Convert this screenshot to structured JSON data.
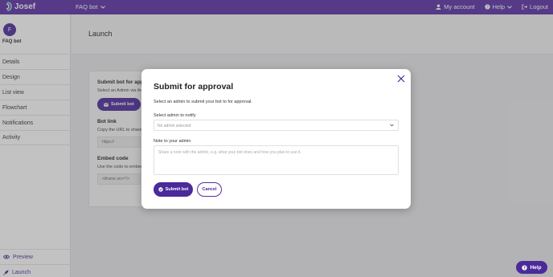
{
  "topbar": {
    "logo_text": "Josef",
    "bot_selector": "FAQ bot",
    "my_account": "My account",
    "help": "Help",
    "logout": "Logout"
  },
  "sidebar": {
    "avatar_letter": "F",
    "bot_name": "FAQ bot",
    "items": [
      {
        "label": "Details"
      },
      {
        "label": "Design"
      },
      {
        "label": "List view"
      },
      {
        "label": "Flowchart"
      },
      {
        "label": "Notifications"
      },
      {
        "label": "Activity"
      }
    ],
    "preview": "Preview",
    "launch": "Launch"
  },
  "main": {
    "title": "Launch",
    "card": {
      "submit_heading": "Submit bot for approval",
      "submit_desc": "Select an Admin via the",
      "submit_button": "Submit bot",
      "link_heading": "Bot link",
      "link_desc": "Copy the URL to share y",
      "link_value": "https://",
      "embed_heading": "Embed code",
      "embed_desc": "Use the code to embed y",
      "embed_value": "<iframe src=\"/>"
    }
  },
  "modal": {
    "title": "Submit for approval",
    "description": "Select an admin to submit your bot to for approval.",
    "admin_label": "Select admin to notify",
    "admin_selected": "No admin selected",
    "note_label": "Note to your admin",
    "note_placeholder": "Share a note with the admin, e.g. what your bot does and how you plan to use it.",
    "submit_button": "Submit bot",
    "cancel_button": "Cancel"
  },
  "help_button": "Help",
  "colors": {
    "brand": "#5a2ea6",
    "brand_dark": "#4b2a9a"
  }
}
